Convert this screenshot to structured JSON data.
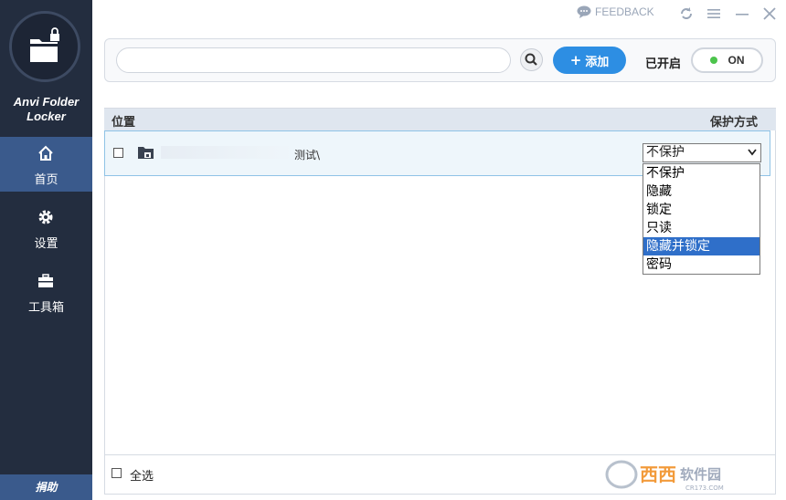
{
  "app": {
    "brand": "Anvi Folder Locker"
  },
  "sidebar": {
    "items": [
      {
        "label": "首页",
        "icon": "home-icon",
        "active": true
      },
      {
        "label": "设置",
        "icon": "gear-icon",
        "active": false
      },
      {
        "label": "工具箱",
        "icon": "toolbox-icon",
        "active": false
      }
    ],
    "donate_label": "捐助"
  },
  "titlebar": {
    "feedback_label": "FEEDBACK",
    "buttons": [
      "refresh-icon",
      "menu-icon",
      "minimize-icon",
      "close-icon"
    ]
  },
  "search": {
    "value": "",
    "placeholder": ""
  },
  "toolbar": {
    "add_label": "添加",
    "protection_status_label": "已开启",
    "toggle_label": "ON"
  },
  "list": {
    "headers": {
      "location": "位置",
      "protection": "保护方式"
    },
    "rows": [
      {
        "path": "测试\\",
        "protection": "不保护"
      }
    ]
  },
  "dropdown": {
    "options": [
      "不保护",
      "隐藏",
      "锁定",
      "只读",
      "隐藏并锁定",
      "密码"
    ],
    "highlighted": "隐藏并锁定"
  },
  "footer": {
    "select_all_label": "全选"
  },
  "watermark": {
    "text": "西西软件园",
    "url_text": "CR173.COM"
  },
  "colors": {
    "sidebar_bg": "#232d3f",
    "active_nav": "#3a5a8c",
    "accent": "#2d8ee3",
    "highlight": "#2f6fc9",
    "on_dot": "#4cc44c"
  }
}
